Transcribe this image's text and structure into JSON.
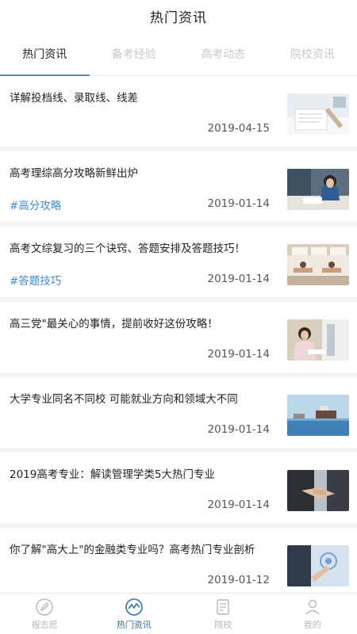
{
  "header": {
    "title": "热门资讯"
  },
  "tabs": [
    {
      "label": "热门资讯",
      "active": true
    },
    {
      "label": "备考经验",
      "active": false
    },
    {
      "label": "高考动态",
      "active": false
    },
    {
      "label": "院校资讯",
      "active": false
    }
  ],
  "articles": [
    {
      "title": "详解投档线、录取线、线差",
      "tag": "",
      "date": "2019-04-15",
      "thumb": "desk-paper"
    },
    {
      "title": "高考理综高分攻略新鲜出炉",
      "tag": "#高分攻略",
      "date": "2019-01-14",
      "thumb": "student-studying"
    },
    {
      "title": "高考文综复习的三个诀窍、答题安排及答题技巧！",
      "tag": "#答题技巧",
      "date": "2019-01-14",
      "thumb": "classroom"
    },
    {
      "title": "高三党\"最关心的事情，提前收好这份攻略！",
      "tag": "",
      "date": "2019-01-14",
      "thumb": "girl-writing"
    },
    {
      "title": "大学专业同名不同校 可能就业方向和领域大不同",
      "tag": "",
      "date": "2019-01-14",
      "thumb": "harbor-ship"
    },
    {
      "title": "2019高考专业：解读管理学类5大热门专业",
      "tag": "",
      "date": "2019-01-14",
      "thumb": "handshake"
    },
    {
      "title": "你了解\"高大上\"的金融类专业吗？高考热门专业剖析",
      "tag": "",
      "date": "2019-01-12",
      "thumb": "finance-touch"
    }
  ],
  "bottom_nav": [
    {
      "label": "报志愿",
      "icon": "pen-circle-icon",
      "active": false
    },
    {
      "label": "热门资讯",
      "icon": "trend-circle-icon",
      "active": true
    },
    {
      "label": "院校",
      "icon": "document-icon",
      "active": false
    },
    {
      "label": "我的",
      "icon": "user-icon",
      "active": false
    }
  ],
  "colors": {
    "accent": "#4a8fc8",
    "tag": "#3f8bd0",
    "nav_active": "#2f6fb0"
  }
}
